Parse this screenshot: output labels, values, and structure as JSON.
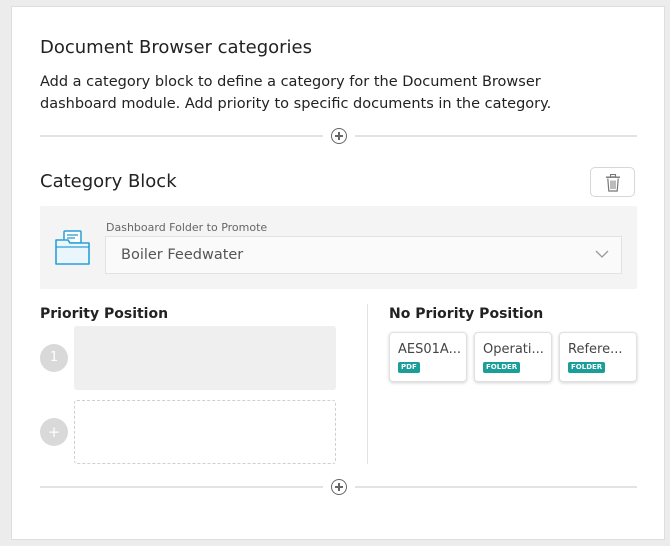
{
  "header": {
    "title": "Document Browser categories",
    "description": "Add a category block to define a category for the Document Browser dashboard module. Add priority to specific documents in the category."
  },
  "category_block": {
    "title": "Category Block",
    "folder_label": "Dashboard Folder to Promote",
    "folder_value": "Boiler Feedwater"
  },
  "priority": {
    "title": "Priority Position",
    "slot_number": "1",
    "add_glyph": "+"
  },
  "no_priority": {
    "title": "No Priority Position",
    "cards": [
      {
        "name": "AES01A...",
        "type": "PDF"
      },
      {
        "name": "Operati...",
        "type": "FOLDER"
      },
      {
        "name": "Refere...",
        "type": "FOLDER"
      }
    ]
  },
  "icons": {
    "add_between": "plus-circle-icon",
    "delete": "trash-icon",
    "folder": "folder-documents-icon",
    "dropdown": "chevron-down-icon"
  },
  "colors": {
    "badge": "#1a9e9a",
    "folder_icon": "#2a9fd6"
  }
}
